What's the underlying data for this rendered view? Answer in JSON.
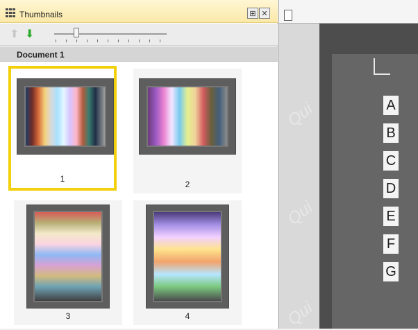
{
  "left_panel": {
    "title": "Thumbnails",
    "toolbar": {
      "slider_value": 0.2
    },
    "document_title": "Document 1",
    "thumbnails": [
      {
        "label": "1"
      },
      {
        "label": "2"
      },
      {
        "label": "3"
      },
      {
        "label": "4"
      }
    ]
  },
  "right_panel": {
    "watermark": "Qui",
    "row_letters": [
      "A",
      "B",
      "C",
      "D",
      "E",
      "F",
      "G"
    ]
  },
  "colors": {
    "selection": "#f2d00b",
    "title_bar": "#fbe9a9",
    "background": "#ffffff"
  }
}
